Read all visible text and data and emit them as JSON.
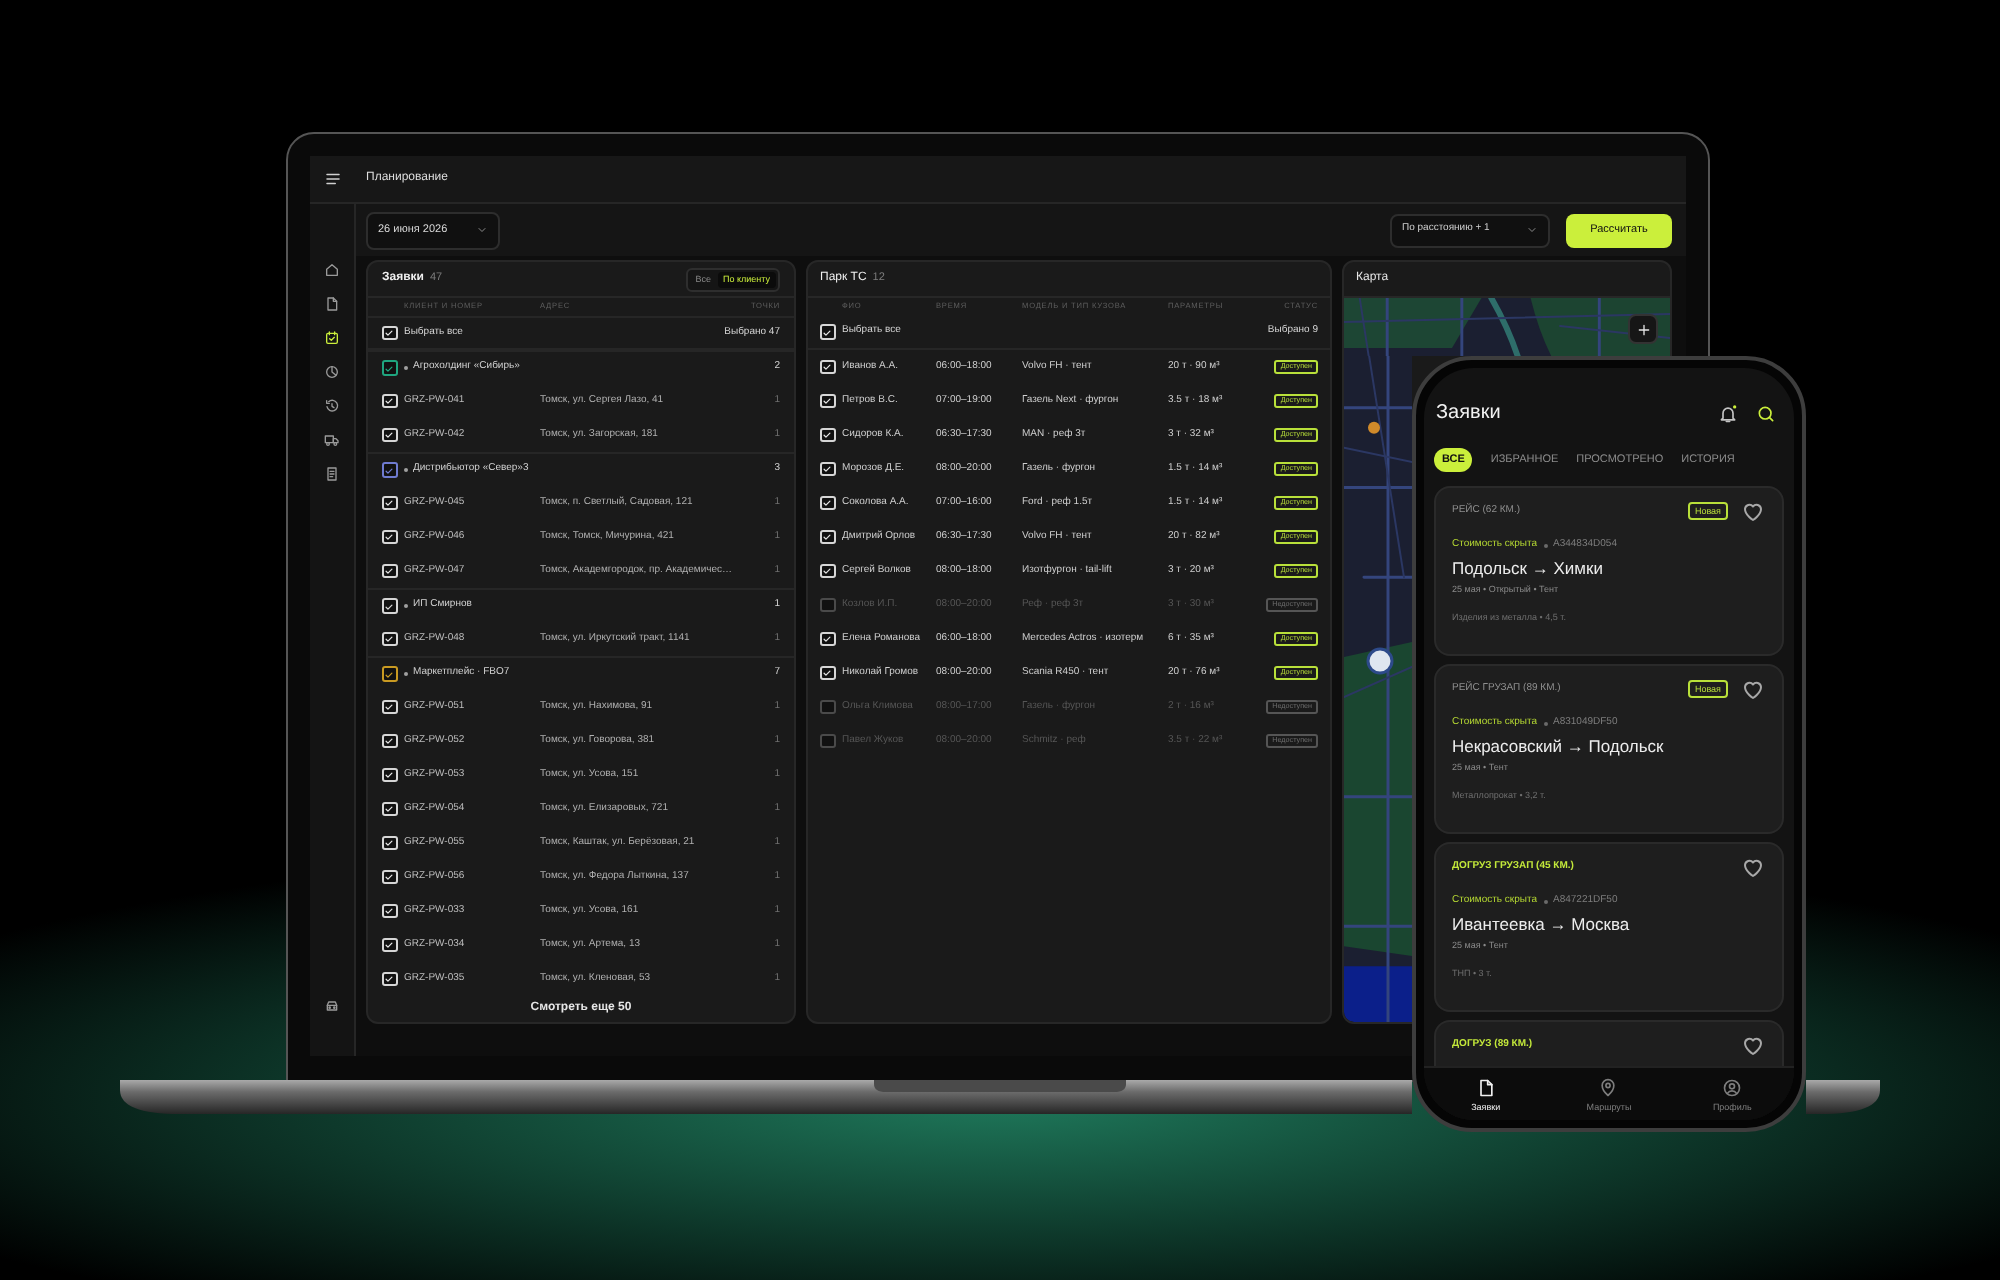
{
  "laptop": {
    "header": {
      "title": "Планирование"
    },
    "sidebar": [
      {
        "selected": false
      },
      {
        "selected": false
      },
      {
        "selected": true
      },
      {
        "selected": false
      },
      {
        "selected": false
      },
      {
        "selected": false
      },
      {
        "selected": false
      }
    ],
    "toolbar": {
      "date": "26 июня 2026",
      "sort": "По расстоянию + 1",
      "calculate_button": "Рассчитать"
    },
    "orders": {
      "title": "Заявки",
      "count": "47",
      "view_toggle": [
        {
          "label": "Все",
          "selected": false
        },
        {
          "label": "По клиенту",
          "selected": true
        }
      ],
      "columns": [
        "КЛИЕНТ И НОМЕР",
        "АДРЕС",
        "ТОЧКИ"
      ],
      "select_all": {
        "label": "Выбрать все",
        "checked": true,
        "summary": "Выбрано 47"
      },
      "rows": [
        {
          "kind": "group",
          "name": "Агрохолдинг «Сибирь»",
          "checked": true,
          "color": "#1fa57f",
          "points": "2"
        },
        {
          "kind": "order",
          "number": "GRZ-PW-041",
          "address": "Томск, ул. Сергея Лазо, 41",
          "checked": true,
          "points": "1"
        },
        {
          "kind": "order",
          "number": "GRZ-PW-042",
          "address": "Томск, ул. Загорская, 181",
          "checked": true,
          "points": "1"
        },
        {
          "kind": "group",
          "name": "Дистрибьютор «Север»3",
          "checked": true,
          "color": "#6f7bd0",
          "points": "3"
        },
        {
          "kind": "order",
          "number": "GRZ-PW-045",
          "address": "Томск, п. Светлый, Садовая, 121",
          "checked": true,
          "points": "1"
        },
        {
          "kind": "order",
          "number": "GRZ-PW-046",
          "address": "Томск, Томск, Мичурина, 421",
          "checked": true,
          "points": "1"
        },
        {
          "kind": "order",
          "number": "GRZ-PW-047",
          "address": "Томск, Академгородок, пр. Академичес…",
          "checked": true,
          "points": "1"
        },
        {
          "kind": "group",
          "name": "ИП Смирнов",
          "checked": true,
          "color": "#d6d6d6",
          "points": "1"
        },
        {
          "kind": "order",
          "number": "GRZ-PW-048",
          "address": "Томск, ул. Иркутский тракт, 1141",
          "checked": true,
          "points": "1"
        },
        {
          "kind": "group",
          "name": "Маркетплейс · FBO7",
          "checked": true,
          "color": "#c99a22",
          "points": "7"
        },
        {
          "kind": "order",
          "number": "GRZ-PW-051",
          "address": "Томск, ул. Нахимова, 91",
          "checked": true,
          "points": "1"
        },
        {
          "kind": "order",
          "number": "GRZ-PW-052",
          "address": "Томск, ул. Говорова, 381",
          "checked": true,
          "points": "1"
        },
        {
          "kind": "order",
          "number": "GRZ-PW-053",
          "address": "Томск, ул. Усова, 151",
          "checked": true,
          "points": "1"
        },
        {
          "kind": "order",
          "number": "GRZ-PW-054",
          "address": "Томск, ул. Елизаровых, 721",
          "checked": true,
          "points": "1"
        },
        {
          "kind": "order",
          "number": "GRZ-PW-055",
          "address": "Томск, Каштак, ул. Берёзовая, 21",
          "checked": true,
          "points": "1"
        },
        {
          "kind": "order",
          "number": "GRZ-PW-056",
          "address": "Томск, ул. Федора Лыткина, 137",
          "checked": true,
          "points": "1"
        },
        {
          "kind": "order",
          "number": "GRZ-PW-033",
          "address": "Томск, ул. Усова, 161",
          "checked": true,
          "points": "1"
        },
        {
          "kind": "order",
          "number": "GRZ-PW-034",
          "address": "Томск, ул. Артема, 13",
          "checked": true,
          "points": "1"
        },
        {
          "kind": "order",
          "number": "GRZ-PW-035",
          "address": "Томск, ул. Кленовая, 53",
          "checked": true,
          "points": "1"
        }
      ],
      "more_button": "Смотреть еще 50"
    },
    "fleet": {
      "title": "Парк ТС",
      "count": "12",
      "columns": [
        "ФИО",
        "ВРЕМЯ",
        "МОДЕЛЬ И ТИП КУЗОВА",
        "ПАРАМЕТРЫ",
        "СТАТУС"
      ],
      "select_all": {
        "label": "Выбрать все",
        "checked": true,
        "summary": "Выбрано 9"
      },
      "rows": [
        {
          "name": "Иванов А.А.",
          "hours": "06:00–18:00",
          "model": "Volvo FH · тент",
          "params": "20 т · 90 м³",
          "status": "Доступен",
          "available": true,
          "checked": true
        },
        {
          "name": "Петров В.С.",
          "hours": "07:00–19:00",
          "model": "Газель Next · фургон",
          "params": "3.5 т · 18 м³",
          "status": "Доступен",
          "available": true,
          "checked": true
        },
        {
          "name": "Сидоров К.А.",
          "hours": "06:30–17:30",
          "model": "MAN · реф 3т",
          "params": "3 т · 32 м³",
          "status": "Доступен",
          "available": true,
          "checked": true
        },
        {
          "name": "Морозов Д.Е.",
          "hours": "08:00–20:00",
          "model": "Газель · фургон",
          "params": "1.5 т · 14 м³",
          "status": "Доступен",
          "available": true,
          "checked": true
        },
        {
          "name": "Соколова А.А.",
          "hours": "07:00–16:00",
          "model": "Ford · реф 1.5т",
          "params": "1.5 т · 14 м³",
          "status": "Доступен",
          "available": true,
          "checked": true
        },
        {
          "name": "Дмитрий Орлов",
          "hours": "06:30–17:30",
          "model": "Volvo FH · тент",
          "params": "20 т · 82 м³",
          "status": "Доступен",
          "available": true,
          "checked": true
        },
        {
          "name": "Сергей Волков",
          "hours": "08:00–18:00",
          "model": "Изотфургон · tail-lift",
          "params": "3 т · 20 м³",
          "status": "Доступен",
          "available": true,
          "checked": true
        },
        {
          "name": "Козлов И.П.",
          "hours": "08:00–20:00",
          "model": "Реф · реф 3т",
          "params": "3 т · 30 м³",
          "status": "Недоступен",
          "available": false,
          "checked": false
        },
        {
          "name": "Елена Романова",
          "hours": "06:00–18:00",
          "model": "Mercedes Actros · изотерм",
          "params": "6 т · 35 м³",
          "status": "Доступен",
          "available": true,
          "checked": true
        },
        {
          "name": "Николай Громов",
          "hours": "08:00–20:00",
          "model": "Scania R450 · тент",
          "params": "20 т · 76 м³",
          "status": "Доступен",
          "available": true,
          "checked": true
        },
        {
          "name": "Ольга Климова",
          "hours": "08:00–17:00",
          "model": "Газель · фургон",
          "params": "2 т · 16 м³",
          "status": "Недоступен",
          "available": false,
          "checked": false
        },
        {
          "name": "Павел Жуков",
          "hours": "08:00–20:00",
          "model": "Schmitz · реф",
          "params": "3.5 т · 22 м³",
          "status": "Недоступен",
          "available": false,
          "checked": false
        }
      ]
    },
    "map": {
      "title": "Карта"
    }
  },
  "phone": {
    "title": "Заявки",
    "tabs": [
      {
        "label": "ВСЕ",
        "selected": true
      },
      {
        "label": "ИЗБРАННОЕ",
        "selected": false
      },
      {
        "label": "ПРОСМОТРЕНО",
        "selected": false
      },
      {
        "label": "ИСТОРИЯ",
        "selected": false
      }
    ],
    "cards": [
      {
        "title": "РЕЙС (62 КМ.)",
        "highlighted": false,
        "badge": "Новая",
        "price": "Стоимость скрыта",
        "code": "A344834D054",
        "route": "Подольск → Химки",
        "details": "25 мая • Открытый • Тент",
        "cargo": "Изделия из металла • 4,5 т."
      },
      {
        "title": "РЕЙС ГРУЗАП (89 КМ.)",
        "highlighted": false,
        "badge": "Новая",
        "price": "Стоимость скрыта",
        "code": "A831049DF50",
        "route": "Некрасовский → Подольск",
        "details": "25 мая • Тент",
        "cargo": "Металлопрокат • 3,2 т."
      },
      {
        "title": "ДОГРУЗ ГРУЗАП (45 КМ.)",
        "highlighted": true,
        "price": "Стоимость скрыта",
        "code": "A847221DF50",
        "route": "Ивантеевка → Москва",
        "details": "25 мая • Тент",
        "cargo": "ТНП • 3 т."
      },
      {
        "title": "ДОГРУЗ (89 КМ.)",
        "highlighted": true
      }
    ],
    "bottom_nav": [
      {
        "label": "Заявки",
        "selected": true
      },
      {
        "label": "Маршруты",
        "selected": false
      },
      {
        "label": "Профиль",
        "selected": false
      }
    ]
  }
}
